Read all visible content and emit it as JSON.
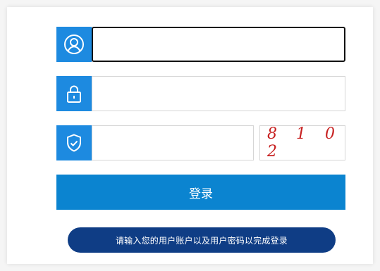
{
  "form": {
    "username": {
      "icon": "user-icon",
      "value": "",
      "placeholder": ""
    },
    "password": {
      "icon": "lock-icon",
      "value": "",
      "placeholder": ""
    },
    "verification": {
      "icon": "shield-check-icon",
      "value": "",
      "placeholder": "",
      "captcha_text": "8 1 0 2"
    },
    "login_label": "登录",
    "tip_text": "请输入您的用户账户以及用户密码以完成登录"
  },
  "colors": {
    "accent": "#1d8ae0",
    "button": "#0b84d0",
    "tip_bg": "#0f3d85",
    "captcha": "#c72020"
  }
}
